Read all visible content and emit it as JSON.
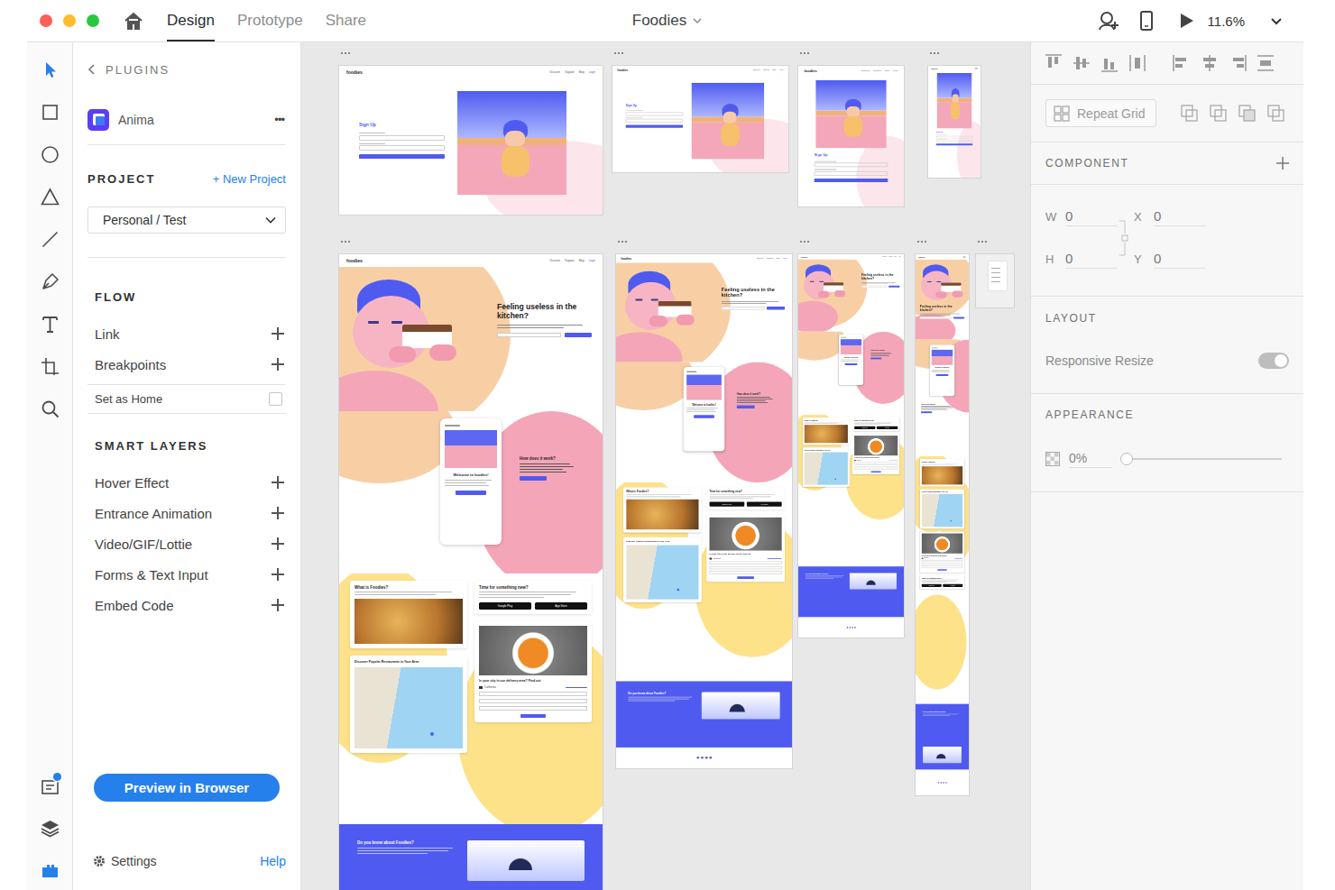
{
  "window": {
    "title": "Foodies"
  },
  "mode_tabs": [
    {
      "label": "Design",
      "selected": true
    },
    {
      "label": "Prototype",
      "selected": false
    },
    {
      "label": "Share",
      "selected": false
    }
  ],
  "zoom": {
    "value": "11.6%"
  },
  "tools": [
    {
      "selected": true
    },
    {
      "selected": false
    },
    {
      "selected": false
    },
    {
      "selected": false
    },
    {
      "selected": false
    },
    {
      "selected": false
    },
    {
      "selected": false
    },
    {
      "selected": false
    },
    {
      "selected": false
    }
  ],
  "bottom_tools": [
    {
      "selected": false,
      "badge": true
    },
    {
      "selected": false,
      "badge": false
    },
    {
      "selected": true,
      "badge": false
    }
  ],
  "plugins_panel": {
    "back_label": "PLUGINS",
    "plugin": {
      "name": "Anima",
      "menu": "•••"
    },
    "project": {
      "heading": "PROJECT",
      "new_label": "+ New Project",
      "selected": "Personal / Test"
    },
    "flow": {
      "heading": "FLOW",
      "items": [
        {
          "label": "Link",
          "kind": "add"
        },
        {
          "label": "Breakpoints",
          "kind": "add"
        },
        {
          "label": "Set as Home",
          "kind": "checkbox",
          "checked": false
        }
      ]
    },
    "smart_layers": {
      "heading": "SMART LAYERS",
      "items": [
        {
          "label": "Hover Effect"
        },
        {
          "label": "Entrance Animation"
        },
        {
          "label": "Video/GIF/Lottie"
        },
        {
          "label": "Forms & Text Input"
        },
        {
          "label": "Embed Code"
        }
      ]
    },
    "preview_button": "Preview in Browser",
    "settings": "Settings",
    "help": "Help"
  },
  "properties_panel": {
    "repeat_grid": {
      "label": "Repeat Grid",
      "disabled": true
    },
    "component": {
      "heading": "COMPONENT"
    },
    "dimensions": [
      {
        "label": "W",
        "value": "0"
      },
      {
        "label": "X",
        "value": "0"
      },
      {
        "label": "H",
        "value": "0"
      },
      {
        "label": "Y",
        "value": "0"
      }
    ],
    "layout": {
      "heading": "LAYOUT",
      "responsive_resize": {
        "label": "Responsive Resize",
        "on": true,
        "disabled": true
      }
    },
    "appearance": {
      "heading": "APPEARANCE",
      "opacity": {
        "value": "0%",
        "level": 0
      }
    }
  },
  "artboards": [
    {
      "kind": "signup",
      "logo": "foodies",
      "nav": [
        "Discover",
        "Support",
        "Blog",
        "Login"
      ],
      "title": "Sign Up"
    },
    {
      "kind": "signup",
      "logo": "foodies",
      "nav": [
        "Discover",
        "Support",
        "Blog",
        "Login"
      ],
      "title": "Sign Up"
    },
    {
      "kind": "signup",
      "logo": "foodies",
      "nav": [
        "Discover",
        "Support",
        "Blog",
        "Login"
      ],
      "title": "Sign Up"
    },
    {
      "kind": "signup",
      "logo": "foodies",
      "nav": [],
      "title": "Sign Up"
    },
    {
      "kind": "landing",
      "logo": "foodies",
      "nav": [
        "Discover",
        "Support",
        "Blog",
        "Login"
      ],
      "hero_title": "Feeling useless in the kitchen?",
      "phone_title": "Welcome to foodies!",
      "how_title": "How does it work?",
      "what_title": "What is Foodies?",
      "time_title": "Time for something new?",
      "stores": [
        "Google Play",
        "App Store"
      ],
      "discover_title": "Discover Popular Restaurants in Your Area",
      "city_title": "Is your city in our delivery area? Find out",
      "city_value": "California",
      "footer_title": "Do you know about Foodies?"
    },
    {
      "kind": "landing",
      "logo": "foodies",
      "nav": [
        "Discover",
        "Support",
        "Blog",
        "Login"
      ],
      "hero_title": "Feeling useless in the kitchen?",
      "phone_title": "Welcome to foodies!",
      "how_title": "How does it work?",
      "what_title": "What is Foodies?",
      "time_title": "Time for something new?",
      "stores": [
        "Google Play",
        "App Store"
      ],
      "discover_title": "Discover Popular Restaurants in Your Area",
      "city_title": "Is your city in our delivery area? Find out",
      "city_value": "California",
      "footer_title": "Do you know about Foodies?"
    },
    {
      "kind": "landing",
      "logo": "foodies",
      "nav": [
        "Discover",
        "Support",
        "Blog",
        "Login"
      ],
      "hero_title": "Feeling useless in the kitchen?",
      "phone_title": "Welcome to foodies!",
      "how_title": "How does it work?",
      "what_title": "What is Foodies?",
      "time_title": "Time for something new?",
      "stores": [
        "Google Play",
        "App Store"
      ],
      "discover_title": "Discover Popular Restaurants in Your Area",
      "city_title": "Is your city in our delivery area? Find out",
      "city_value": "California",
      "footer_title": "Do you know about Foodies?"
    },
    {
      "kind": "landing",
      "logo": "foodies",
      "nav": [],
      "hero_title": "Feeling useless in the kitchen?",
      "phone_title": "Welcome to foodies!",
      "how_title": "How does it work?",
      "what_title": "What is Foodies?",
      "time_title": "Time for something new?",
      "stores": [
        "Google Play",
        "App Store"
      ],
      "discover_title": "Discover Popular Restaurants in Your Area",
      "city_title": "Is your city in our delivery area? Find out",
      "city_value": "California",
      "footer_title": "Do you know about Foodies?"
    },
    {
      "kind": "menu"
    }
  ]
}
